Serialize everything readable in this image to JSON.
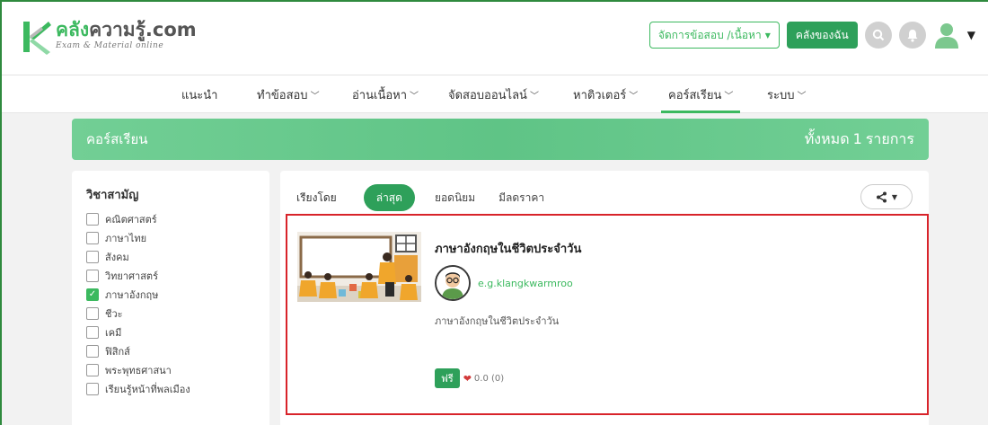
{
  "header": {
    "logo_name_accent": "คลัง",
    "logo_name_rest": "ความรู้.com",
    "logo_tagline": "Exam & Material online",
    "manage_button": "จัดการข้อสอบ /เนื้อหา",
    "library_button": "คลังของฉัน",
    "icons": [
      "search-icon",
      "bell-icon",
      "user-avatar-icon",
      "caret-down-icon"
    ]
  },
  "nav": {
    "items": [
      {
        "label": "แนะนำ"
      },
      {
        "label": "ทำข้อสอบ"
      },
      {
        "label": "อ่านเนื้อหา"
      },
      {
        "label": "จัดสอบออนไลน์"
      },
      {
        "label": "หาติวเตอร์"
      },
      {
        "label": "คอร์สเรียน"
      },
      {
        "label": "ระบบ"
      }
    ],
    "active": "คอร์สเรียน"
  },
  "banner": {
    "title": "คอร์สเรียน",
    "count_prefix": "ทั้งหมด",
    "count": "1",
    "count_suffix": "รายการ"
  },
  "sidebar": {
    "heading": "วิชาสามัญ",
    "subjects": [
      {
        "label": "คณิตศาสตร์",
        "checked": false
      },
      {
        "label": "ภาษาไทย",
        "checked": false
      },
      {
        "label": "สังคม",
        "checked": false
      },
      {
        "label": "วิทยาศาสตร์",
        "checked": false
      },
      {
        "label": "ภาษาอังกฤษ",
        "checked": true
      },
      {
        "label": "ชีวะ",
        "checked": false
      },
      {
        "label": "เคมี",
        "checked": false
      },
      {
        "label": "ฟิสิกส์",
        "checked": false
      },
      {
        "label": "พระพุทธศาสนา",
        "checked": false
      },
      {
        "label": "เรียนรู้หน้าที่พลเมือง",
        "checked": false
      }
    ]
  },
  "sort": {
    "label": "เรียงโดย",
    "options": [
      "ล่าสุด",
      "ยอดนิยม",
      "มีลดราคา"
    ],
    "selected": "ล่าสุด"
  },
  "course": {
    "title": "ภาษาอังกฤษในชีวิตประจำวัน",
    "author": "e.g.klangkwarmroo",
    "description": "ภาษาอังกฤษในชีวิตประจำวัน",
    "price_badge": "ฟรี",
    "rating": "0.0 (0)"
  },
  "colors": {
    "accent": "#3cb95f",
    "accent_dark": "#2ea05a",
    "highlight_border": "#d8232a",
    "heart": "#d23a3a"
  }
}
